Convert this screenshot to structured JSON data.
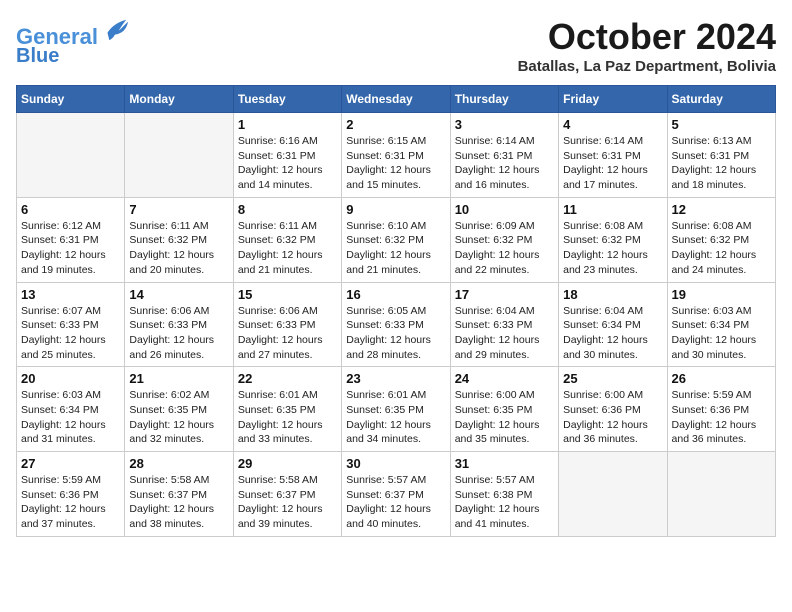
{
  "header": {
    "logo_line1": "General",
    "logo_line2": "Blue",
    "month_title": "October 2024",
    "location": "Batallas, La Paz Department, Bolivia"
  },
  "weekdays": [
    "Sunday",
    "Monday",
    "Tuesday",
    "Wednesday",
    "Thursday",
    "Friday",
    "Saturday"
  ],
  "weeks": [
    [
      {
        "day": "",
        "info": ""
      },
      {
        "day": "",
        "info": ""
      },
      {
        "day": "1",
        "info": "Sunrise: 6:16 AM\nSunset: 6:31 PM\nDaylight: 12 hours\nand 14 minutes."
      },
      {
        "day": "2",
        "info": "Sunrise: 6:15 AM\nSunset: 6:31 PM\nDaylight: 12 hours\nand 15 minutes."
      },
      {
        "day": "3",
        "info": "Sunrise: 6:14 AM\nSunset: 6:31 PM\nDaylight: 12 hours\nand 16 minutes."
      },
      {
        "day": "4",
        "info": "Sunrise: 6:14 AM\nSunset: 6:31 PM\nDaylight: 12 hours\nand 17 minutes."
      },
      {
        "day": "5",
        "info": "Sunrise: 6:13 AM\nSunset: 6:31 PM\nDaylight: 12 hours\nand 18 minutes."
      }
    ],
    [
      {
        "day": "6",
        "info": "Sunrise: 6:12 AM\nSunset: 6:31 PM\nDaylight: 12 hours\nand 19 minutes."
      },
      {
        "day": "7",
        "info": "Sunrise: 6:11 AM\nSunset: 6:32 PM\nDaylight: 12 hours\nand 20 minutes."
      },
      {
        "day": "8",
        "info": "Sunrise: 6:11 AM\nSunset: 6:32 PM\nDaylight: 12 hours\nand 21 minutes."
      },
      {
        "day": "9",
        "info": "Sunrise: 6:10 AM\nSunset: 6:32 PM\nDaylight: 12 hours\nand 21 minutes."
      },
      {
        "day": "10",
        "info": "Sunrise: 6:09 AM\nSunset: 6:32 PM\nDaylight: 12 hours\nand 22 minutes."
      },
      {
        "day": "11",
        "info": "Sunrise: 6:08 AM\nSunset: 6:32 PM\nDaylight: 12 hours\nand 23 minutes."
      },
      {
        "day": "12",
        "info": "Sunrise: 6:08 AM\nSunset: 6:32 PM\nDaylight: 12 hours\nand 24 minutes."
      }
    ],
    [
      {
        "day": "13",
        "info": "Sunrise: 6:07 AM\nSunset: 6:33 PM\nDaylight: 12 hours\nand 25 minutes."
      },
      {
        "day": "14",
        "info": "Sunrise: 6:06 AM\nSunset: 6:33 PM\nDaylight: 12 hours\nand 26 minutes."
      },
      {
        "day": "15",
        "info": "Sunrise: 6:06 AM\nSunset: 6:33 PM\nDaylight: 12 hours\nand 27 minutes."
      },
      {
        "day": "16",
        "info": "Sunrise: 6:05 AM\nSunset: 6:33 PM\nDaylight: 12 hours\nand 28 minutes."
      },
      {
        "day": "17",
        "info": "Sunrise: 6:04 AM\nSunset: 6:33 PM\nDaylight: 12 hours\nand 29 minutes."
      },
      {
        "day": "18",
        "info": "Sunrise: 6:04 AM\nSunset: 6:34 PM\nDaylight: 12 hours\nand 30 minutes."
      },
      {
        "day": "19",
        "info": "Sunrise: 6:03 AM\nSunset: 6:34 PM\nDaylight: 12 hours\nand 30 minutes."
      }
    ],
    [
      {
        "day": "20",
        "info": "Sunrise: 6:03 AM\nSunset: 6:34 PM\nDaylight: 12 hours\nand 31 minutes."
      },
      {
        "day": "21",
        "info": "Sunrise: 6:02 AM\nSunset: 6:35 PM\nDaylight: 12 hours\nand 32 minutes."
      },
      {
        "day": "22",
        "info": "Sunrise: 6:01 AM\nSunset: 6:35 PM\nDaylight: 12 hours\nand 33 minutes."
      },
      {
        "day": "23",
        "info": "Sunrise: 6:01 AM\nSunset: 6:35 PM\nDaylight: 12 hours\nand 34 minutes."
      },
      {
        "day": "24",
        "info": "Sunrise: 6:00 AM\nSunset: 6:35 PM\nDaylight: 12 hours\nand 35 minutes."
      },
      {
        "day": "25",
        "info": "Sunrise: 6:00 AM\nSunset: 6:36 PM\nDaylight: 12 hours\nand 36 minutes."
      },
      {
        "day": "26",
        "info": "Sunrise: 5:59 AM\nSunset: 6:36 PM\nDaylight: 12 hours\nand 36 minutes."
      }
    ],
    [
      {
        "day": "27",
        "info": "Sunrise: 5:59 AM\nSunset: 6:36 PM\nDaylight: 12 hours\nand 37 minutes."
      },
      {
        "day": "28",
        "info": "Sunrise: 5:58 AM\nSunset: 6:37 PM\nDaylight: 12 hours\nand 38 minutes."
      },
      {
        "day": "29",
        "info": "Sunrise: 5:58 AM\nSunset: 6:37 PM\nDaylight: 12 hours\nand 39 minutes."
      },
      {
        "day": "30",
        "info": "Sunrise: 5:57 AM\nSunset: 6:37 PM\nDaylight: 12 hours\nand 40 minutes."
      },
      {
        "day": "31",
        "info": "Sunrise: 5:57 AM\nSunset: 6:38 PM\nDaylight: 12 hours\nand 41 minutes."
      },
      {
        "day": "",
        "info": ""
      },
      {
        "day": "",
        "info": ""
      }
    ]
  ]
}
